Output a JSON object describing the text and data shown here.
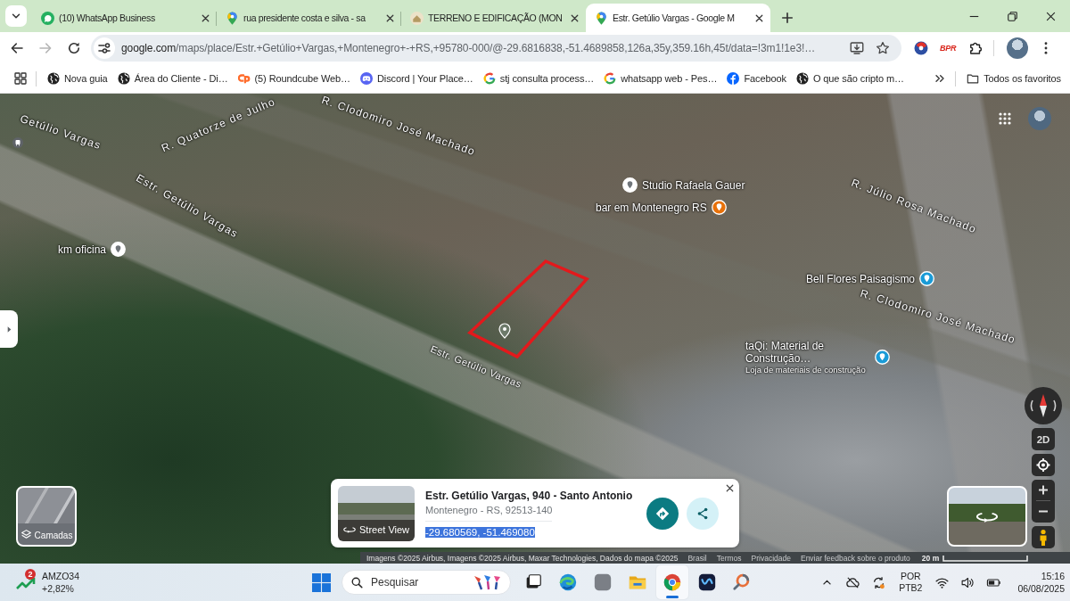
{
  "browser": {
    "tabs": [
      {
        "title": "(10) WhatsApp Business",
        "kind": "chat",
        "selected": false
      },
      {
        "title": "rua presidente costa e silva - sa",
        "kind": "pin",
        "selected": false
      },
      {
        "title": "TERRENO E EDIFICAÇÃO (MON",
        "kind": "house",
        "selected": false
      },
      {
        "title": "Estr. Getúlio Vargas - Google M",
        "kind": "pin",
        "selected": true
      }
    ],
    "navigation": {
      "can_go_forward": false
    },
    "address_bar": {
      "host": "google.com",
      "path": "/maps/place/Estr.+Getúlio+Vargas,+Montenegro+-+RS,+95780-000/@-29.6816838,-51.4689858,126a,35y,359.16h,45t/data=!3m1!1e3!…"
    },
    "extensions": [
      {
        "kind": "ball"
      },
      {
        "kind": "wordmark",
        "label": "BPR"
      },
      {
        "kind": "puzzle"
      }
    ],
    "bookmarks": [
      {
        "label": "Nova guia",
        "kind": "globe"
      },
      {
        "label": "Área do Cliente - Di…",
        "kind": "globe"
      },
      {
        "label": "(5) Roundcube Web…",
        "kind": "swirl"
      },
      {
        "label": "Discord | Your Place…",
        "kind": "controller"
      },
      {
        "label": "stj consulta process…",
        "kind": "gmark"
      },
      {
        "label": "whatsapp web - Pes…",
        "kind": "gmark"
      },
      {
        "label": "Facebook",
        "kind": "fmark"
      },
      {
        "label": "O que são cripto m…",
        "kind": "globe"
      }
    ],
    "all_bookmarks": "Todos os favoritos"
  },
  "map": {
    "street_labels": [
      "Getúlio Vargas",
      "R. Quatorze de Julho",
      "R. Clodomiro José Machado",
      "Estr. Getúlio Vargas",
      "R. Júlio Rosa Machado",
      "R. Clodomiro José Machado",
      "Estr. Getúlio Vargas"
    ],
    "places": [
      {
        "name": "km oficina",
        "color": "#ffffff"
      },
      {
        "name": "Studio Rafaela Gauer",
        "color": "#ffffff"
      },
      {
        "name": "bar em Montenegro RS",
        "color": "#e8710a"
      },
      {
        "name": "Bell Flores Paisagismo",
        "color": "#1a9bd7"
      },
      {
        "name": "taQi: Material de Construção…",
        "color": "#1a9bd7",
        "category": "Loja de materiais de construção"
      }
    ],
    "place_card": {
      "photo_label": "Street View",
      "title": "Estr. Getúlio Vargas, 940 - Santo Antonio",
      "subtitle": "Montenegro - RS, 92513-140",
      "coordinates": {
        "text": "-29.680569, -51.469080",
        "selected": true
      }
    },
    "layers_label": "Camadas",
    "view_toggle": "2D",
    "credits": "Imagens ©2025 Airbus, Imagens ©2025 Airbus, Maxar Technologies, Dados do mapa ©2025",
    "links": [
      "Brasil",
      "Termos",
      "Privacidade",
      "Enviar feedback sobre o produto"
    ],
    "scale": "20 m"
  },
  "taskbar": {
    "stock": {
      "ticker": "AMZO34",
      "change": "+2,82%",
      "badge": "2"
    },
    "search": {
      "placeholder": "Pesquisar"
    },
    "apps": [
      {
        "kind": "taskview",
        "active": false
      },
      {
        "kind": "wave",
        "active": false
      },
      {
        "kind": "tile",
        "active": false
      },
      {
        "kind": "folder",
        "active": false
      },
      {
        "kind": "chrome",
        "active": true
      },
      {
        "kind": "wtile",
        "active": false
      },
      {
        "kind": "ring",
        "active": false
      }
    ],
    "tray": {
      "language": "POR",
      "layout": "PTB2",
      "time": "15:16",
      "date": "06/08/2025"
    }
  }
}
